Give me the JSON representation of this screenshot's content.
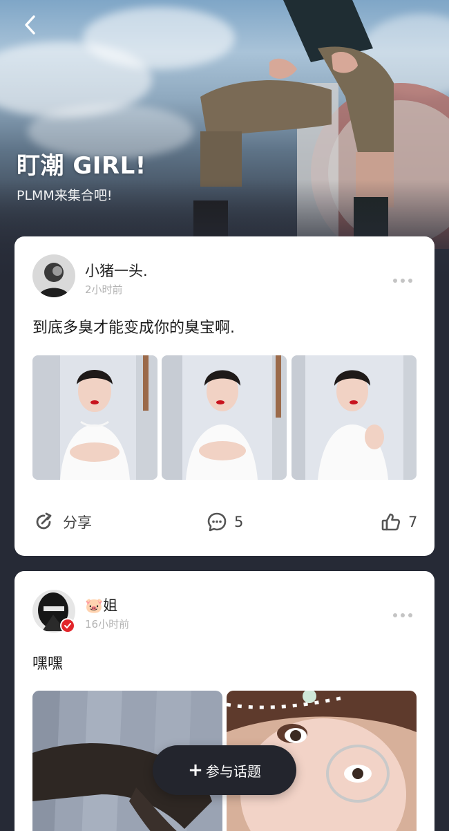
{
  "header": {
    "title": "盯潮 GIRL!",
    "subtitle": "PLMM来集合吧!",
    "back_icon": "chevron-left-icon"
  },
  "posts": [
    {
      "username": "小猪一头.",
      "time": "2小时前",
      "text": "到底多臭才能变成你的臭宝啊.",
      "images": 3,
      "actions": {
        "share_label": "分享",
        "comments": "5",
        "likes": "7"
      }
    },
    {
      "username": "🐷姐",
      "time": "16小时前",
      "text": "嘿嘿",
      "verified": true,
      "images": 2
    }
  ],
  "fab": {
    "label": "参与话题",
    "icon": "plus-icon"
  },
  "colors": {
    "background": "#262a36",
    "card": "#ffffff",
    "fab": "#23252d",
    "verify_badge": "#e2262b"
  }
}
